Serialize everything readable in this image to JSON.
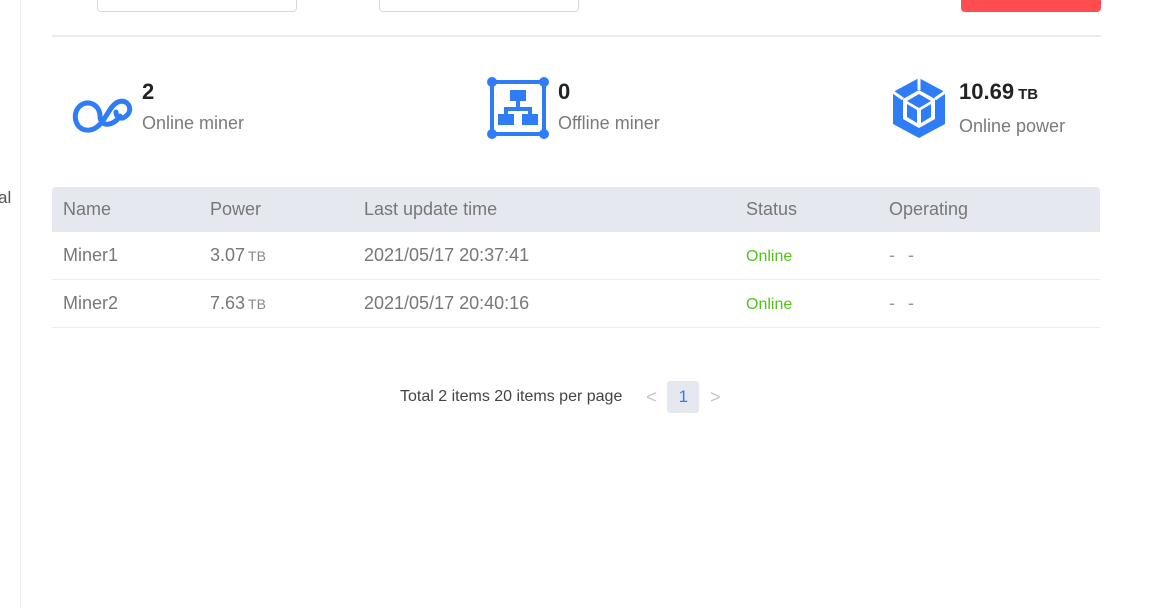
{
  "sidebar": {
    "cut_text": "al"
  },
  "stats": [
    {
      "value": "2",
      "unit": "",
      "label": "Online miner",
      "icon": "online-miner-icon"
    },
    {
      "value": "0",
      "unit": "",
      "label": "Offline miner",
      "icon": "offline-miner-icon"
    },
    {
      "value": "10.69",
      "unit": "TB",
      "label": "Online power",
      "icon": "online-power-icon"
    }
  ],
  "table": {
    "headers": [
      "Name",
      "Power",
      "Last update time",
      "Status",
      "Operating"
    ],
    "rows": [
      {
        "name": "Miner1",
        "power": "3.07",
        "unit": "TB",
        "time": "2021/05/17 20:37:41",
        "status": "Online",
        "operating": "- -"
      },
      {
        "name": "Miner2",
        "power": "7.63",
        "unit": "TB",
        "time": "2021/05/17 20:40:16",
        "status": "Online",
        "operating": "- -"
      }
    ]
  },
  "pagination": {
    "total_text": "Total 2 items 20 items per page",
    "current_page": "1",
    "prev": "<",
    "next": ">"
  },
  "colors": {
    "accent": "#2f7df6",
    "danger": "#ff4d4f",
    "online": "#52c41a"
  }
}
